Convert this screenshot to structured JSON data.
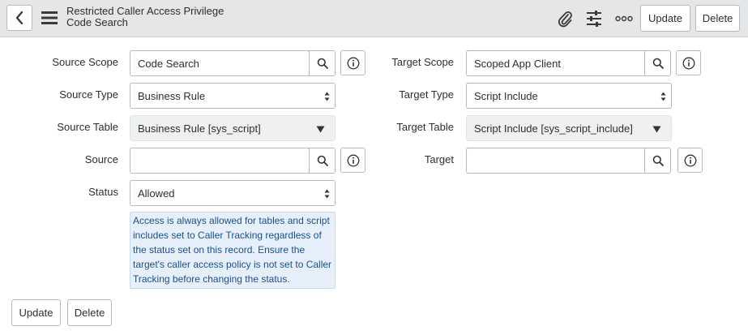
{
  "header": {
    "title_line1": "Restricted Caller Access Privilege",
    "title_line2": "Code Search",
    "update_label": "Update",
    "delete_label": "Delete"
  },
  "form": {
    "source_scope": {
      "label": "Source Scope",
      "value": "Code Search"
    },
    "source_type": {
      "label": "Source Type",
      "value": "Business Rule"
    },
    "source_table": {
      "label": "Source Table",
      "value": "Business Rule [sys_script]"
    },
    "source": {
      "label": "Source",
      "value": ""
    },
    "status": {
      "label": "Status",
      "value": "Allowed"
    },
    "status_notice": "Access is always allowed for tables and script includes set to Caller Tracking regardless of the status set on this record. Ensure the target's caller access policy is not set to Caller Tracking before changing the status.",
    "target_scope": {
      "label": "Target Scope",
      "value": "Scoped App Client"
    },
    "target_type": {
      "label": "Target Type",
      "value": "Script Include"
    },
    "target_table": {
      "label": "Target Table",
      "value": "Script Include [sys_script_include]"
    },
    "target": {
      "label": "Target",
      "value": ""
    }
  },
  "footer": {
    "update_label": "Update",
    "delete_label": "Delete"
  },
  "icons": {
    "back": "chevron-left-icon",
    "menu": "hamburger-icon",
    "attachment": "paperclip-icon",
    "personalize": "sliders-icon",
    "more": "more-options-icon",
    "lookup": "search-icon",
    "info": "info-icon"
  },
  "colors": {
    "header_bg": "#e4e6e7",
    "notice_bg": "#e5f0fb",
    "notice_text": "#1f4e8c"
  }
}
